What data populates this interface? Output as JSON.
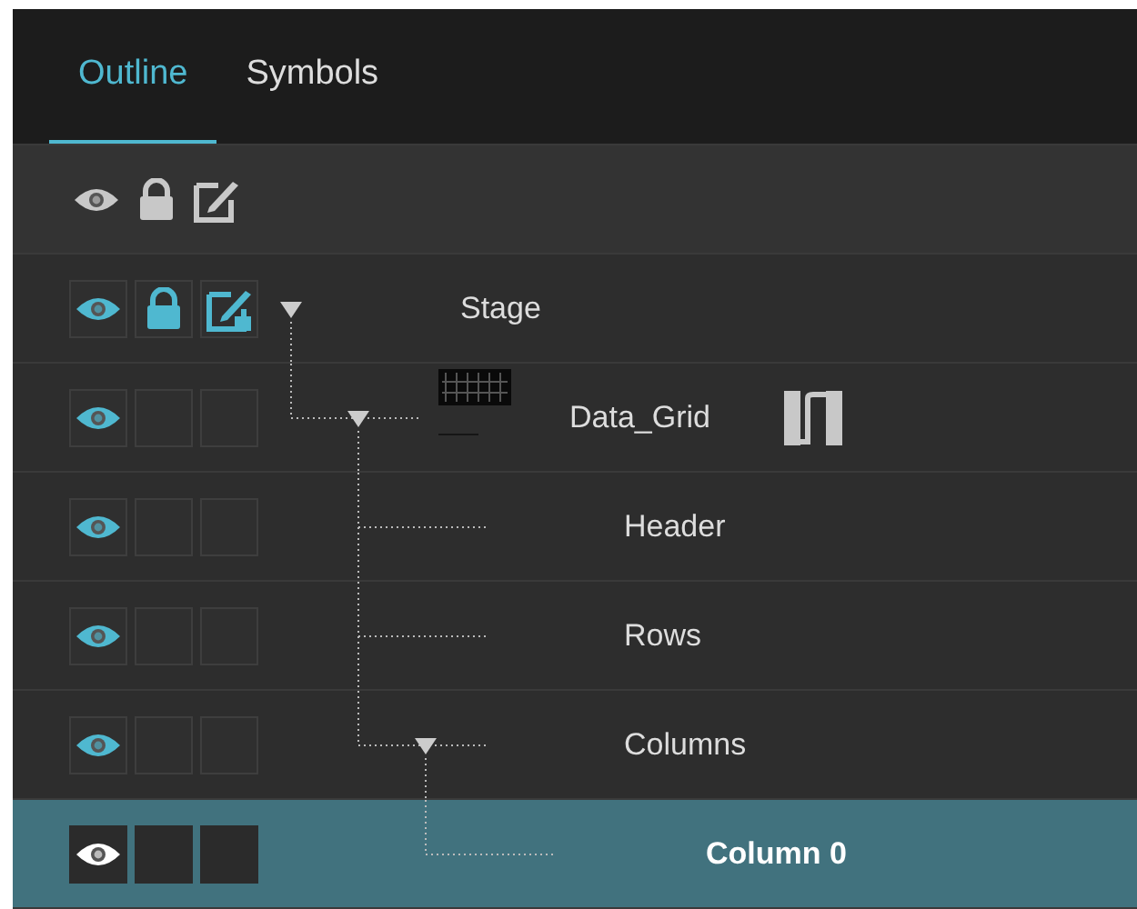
{
  "tabs": [
    {
      "label": "Outline",
      "selected": true
    },
    {
      "label": "Symbols",
      "selected": false
    }
  ],
  "tree": [
    {
      "label": "Stage",
      "symbol": false,
      "visible": true,
      "locked": true,
      "editable": true,
      "selected": false,
      "expanded": true,
      "children": [
        {
          "label": "Data_Grid",
          "symbol": true,
          "visible": true,
          "locked": false,
          "editable": false,
          "selected": false,
          "expanded": true,
          "children": [
            {
              "label": "Header",
              "symbol": false,
              "visible": true,
              "locked": false,
              "editable": false,
              "selected": false
            },
            {
              "label": "Rows",
              "symbol": false,
              "visible": true,
              "locked": false,
              "editable": false,
              "selected": false
            },
            {
              "label": "Columns",
              "symbol": false,
              "visible": true,
              "locked": false,
              "editable": false,
              "selected": false,
              "expanded": true,
              "children": [
                {
                  "label": "Column 0",
                  "symbol": false,
                  "visible": true,
                  "locked": false,
                  "editable": false,
                  "selected": true
                }
              ]
            }
          ]
        }
      ]
    }
  ]
}
